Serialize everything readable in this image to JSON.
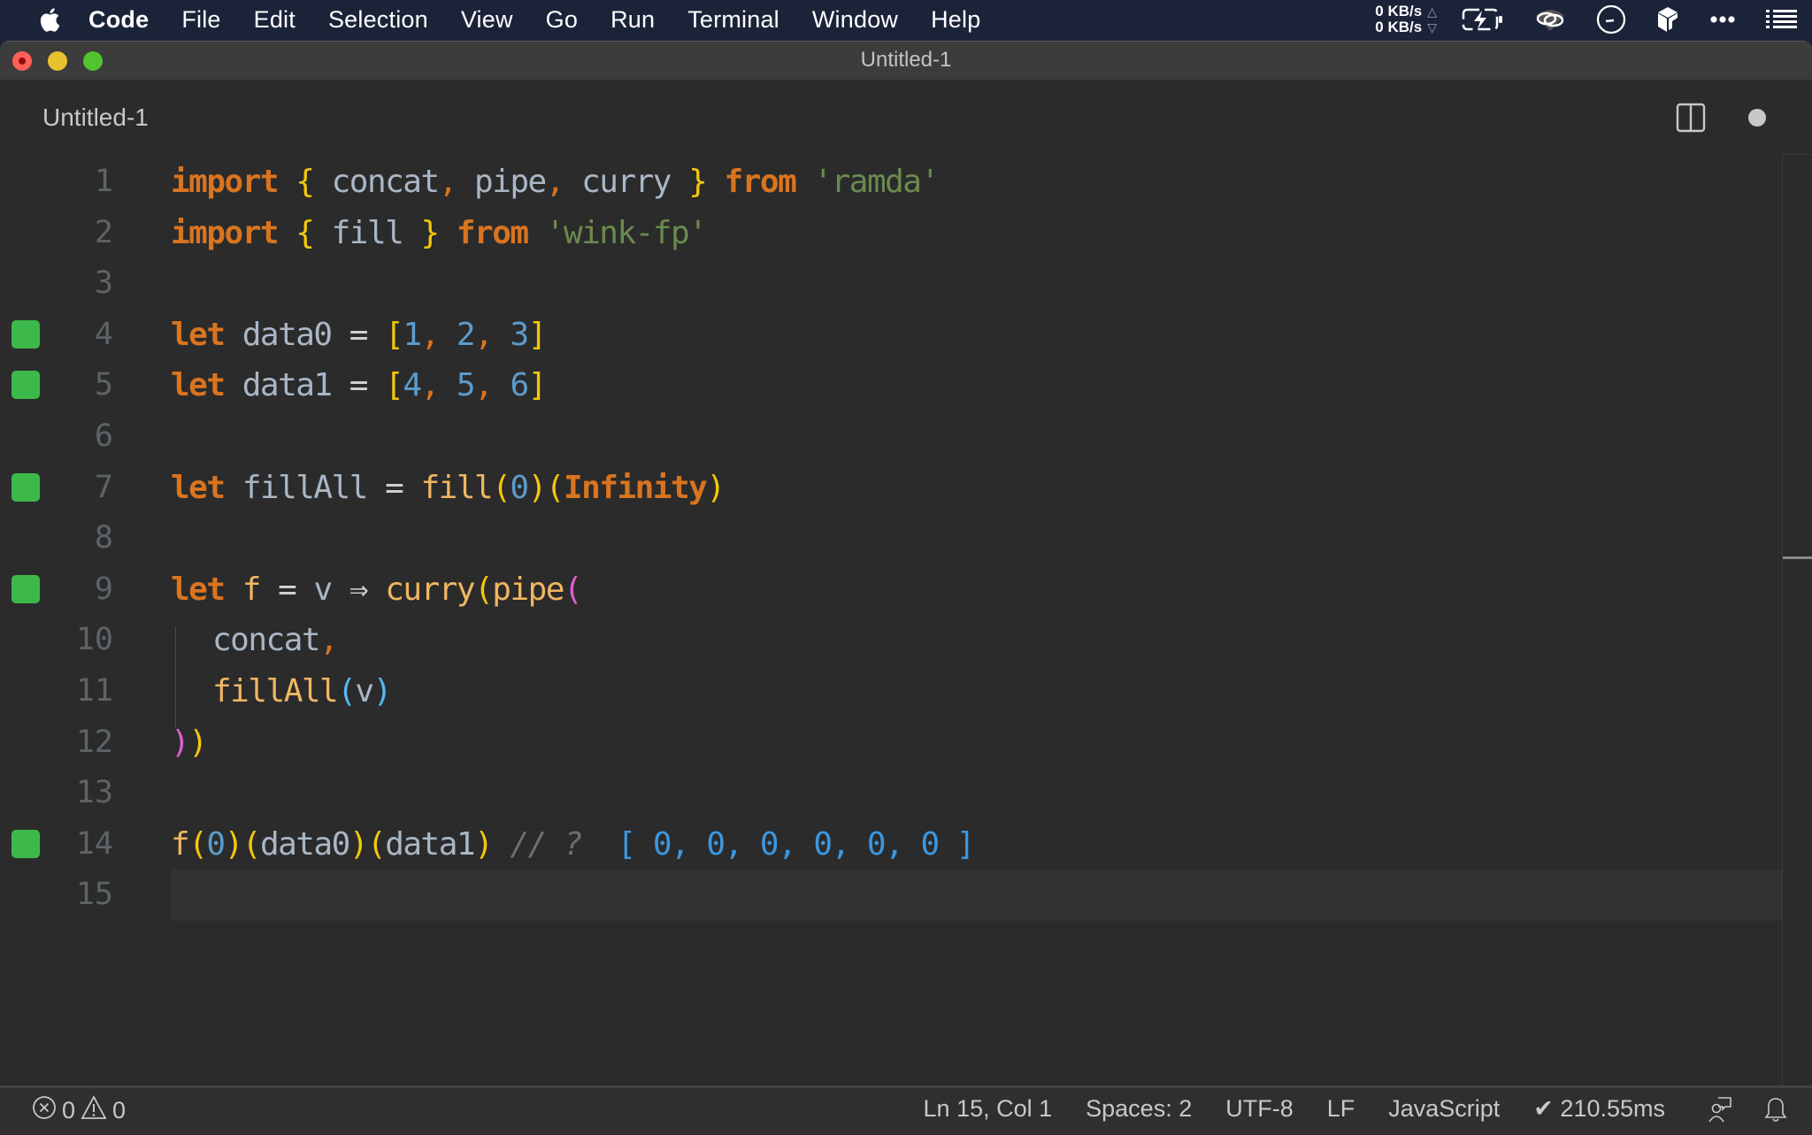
{
  "menubar": {
    "app_name": "Code",
    "items": [
      "File",
      "Edit",
      "Selection",
      "View",
      "Go",
      "Run",
      "Terminal",
      "Window",
      "Help"
    ],
    "net_up": "0 KB/s",
    "net_down": "0 KB/s",
    "net_up_arrow": "△",
    "net_down_arrow": "▽"
  },
  "window": {
    "title": "Untitled-1"
  },
  "tab": {
    "label": "Untitled-1",
    "dirty": true
  },
  "editor": {
    "lines": [
      {
        "n": "1"
      },
      {
        "n": "2"
      },
      {
        "n": "3"
      },
      {
        "n": "4"
      },
      {
        "n": "5"
      },
      {
        "n": "6"
      },
      {
        "n": "7"
      },
      {
        "n": "8"
      },
      {
        "n": "9"
      },
      {
        "n": "10"
      },
      {
        "n": "11"
      },
      {
        "n": "12"
      },
      {
        "n": "13"
      },
      {
        "n": "14"
      },
      {
        "n": "15"
      }
    ],
    "tokens": {
      "import": "import",
      "from": "from",
      "let": "let",
      "lbrace": "{",
      "rbrace": "}",
      "concat": "concat",
      "pipe": "pipe",
      "curry": "curry",
      "fill": "fill",
      "comma": ",",
      "ramda": "'ramda'",
      "winkfp": "'wink-fp'",
      "data0": "data0",
      "data1": "data1",
      "eq": "=",
      "lbr": "[",
      "rbr": "]",
      "n1": "1",
      "n2": "2",
      "n3": "3",
      "n4": "4",
      "n5": "5",
      "n6": "6",
      "n0": "0",
      "fillAll": "fillAll",
      "lp": "(",
      "rp": ")",
      "infinity": "Infinity",
      "f": "f",
      "v": "v",
      "arrow": "⇒",
      "comment": "// ?",
      "result": "[ 0, 0, 0, 0, 0, 0 ]"
    },
    "covered_lines": [
      4,
      5,
      7,
      9,
      14
    ],
    "coverage_color": "#3cb94a"
  },
  "statusbar": {
    "errors": "0",
    "warnings": "0",
    "position": "Ln 15, Col 1",
    "spaces": "Spaces: 2",
    "encoding": "UTF-8",
    "eol": "LF",
    "language": "JavaScript",
    "timing": "✔ 210.55ms"
  }
}
